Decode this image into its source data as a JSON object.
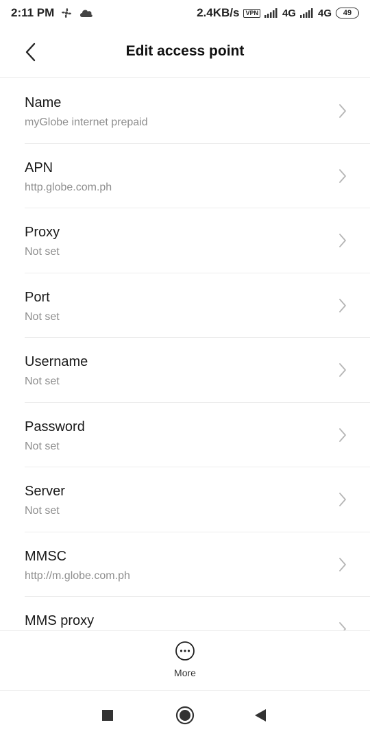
{
  "status_bar": {
    "time": "2:11 PM",
    "speed": "2.4KB/s",
    "vpn": "VPN",
    "network1": "4G",
    "network2": "4G",
    "battery": "49",
    "icons": [
      "fan-icon",
      "cloud-icon",
      "vpn-icon",
      "signal-icon",
      "battery-icon"
    ]
  },
  "header": {
    "title": "Edit access point",
    "back_icon": "back-arrow-icon"
  },
  "items": [
    {
      "title": "Name",
      "value": "myGlobe internet prepaid"
    },
    {
      "title": "APN",
      "value": "http.globe.com.ph"
    },
    {
      "title": "Proxy",
      "value": "Not set"
    },
    {
      "title": "Port",
      "value": "Not set"
    },
    {
      "title": "Username",
      "value": "Not set"
    },
    {
      "title": "Password",
      "value": "Not set"
    },
    {
      "title": "Server",
      "value": "Not set"
    },
    {
      "title": "MMSC",
      "value": "http://m.globe.com.ph"
    },
    {
      "title": "MMS proxy",
      "value": ""
    }
  ],
  "bottom_bar": {
    "more_label": "More",
    "more_icon": "more-dots-icon"
  },
  "nav_bar": {
    "icons": [
      "recents-square-icon",
      "home-circle-icon",
      "back-triangle-icon"
    ]
  },
  "colors": {
    "title_text": "#1a1a1a",
    "secondary_text": "#8e8e8e",
    "divider": "#ececec",
    "chevron": "#b5b5b5"
  }
}
